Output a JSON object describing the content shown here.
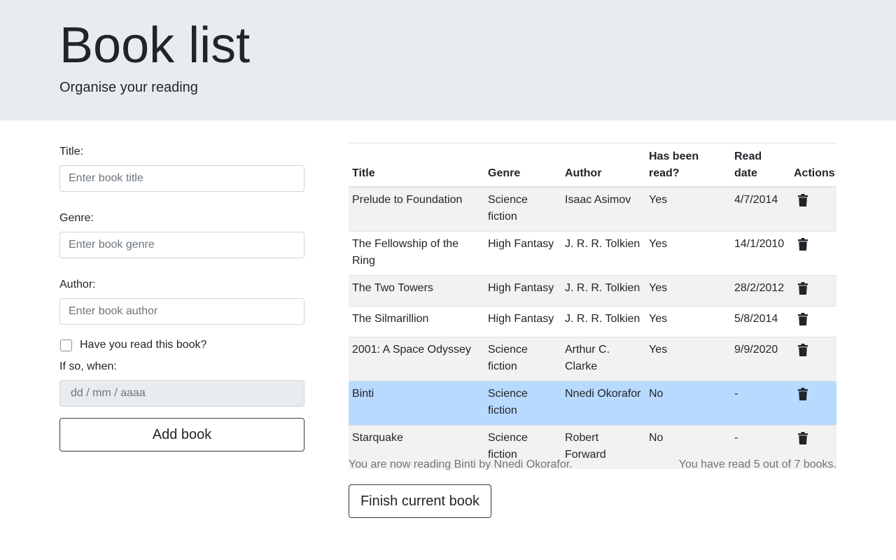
{
  "header": {
    "title": "Book list",
    "subtitle": "Organise your reading"
  },
  "form": {
    "title_label": "Title:",
    "title_placeholder": "Enter book title",
    "genre_label": "Genre:",
    "genre_placeholder": "Enter book genre",
    "author_label": "Author:",
    "author_placeholder": "Enter book author",
    "read_checkbox_label": "Have you read this book?",
    "read_checked": false,
    "date_label": "If so, when:",
    "date_placeholder": "dd / mm / aaaa",
    "add_button": "Add book"
  },
  "table": {
    "headers": [
      "Title",
      "Genre",
      "Author",
      "Has been read?",
      "Read date",
      "Actions"
    ],
    "rows": [
      {
        "title": "Prelude to Foundation",
        "genre": "Science fiction",
        "author": "Isaac Asimov",
        "read": "Yes",
        "date": "4/7/2014",
        "state": "striped"
      },
      {
        "title": "The Fellowship of the Ring",
        "genre": "High Fantasy",
        "author": "J. R. R. Tolkien",
        "read": "Yes",
        "date": "14/1/2010",
        "state": "plain"
      },
      {
        "title": "The Two Towers",
        "genre": "High Fantasy",
        "author": "J. R. R. Tolkien",
        "read": "Yes",
        "date": "28/2/2012",
        "state": "striped"
      },
      {
        "title": "The Silmarillion",
        "genre": "High Fantasy",
        "author": "J. R. R. Tolkien",
        "read": "Yes",
        "date": "5/8/2014",
        "state": "plain"
      },
      {
        "title": "2001: A Space Odyssey",
        "genre": "Science fiction",
        "author": "Arthur C. Clarke",
        "read": "Yes",
        "date": "9/9/2020",
        "state": "striped"
      },
      {
        "title": "Binti",
        "genre": "Science fiction",
        "author": "Nnedi Okorafor",
        "read": "No",
        "date": "-",
        "state": "active"
      },
      {
        "title": "Starquake",
        "genre": "Science fiction",
        "author": "Robert Forward",
        "read": "No",
        "date": "-",
        "state": "striped"
      }
    ],
    "action_icon": "trash-icon"
  },
  "status": {
    "current": "You are now reading Binti by Nnedi Okorafor.",
    "progress": "You have read 5 out of 7 books."
  },
  "finish_button": "Finish current book",
  "colors": {
    "header_bg": "#e9ecef",
    "active_row": "#b8daff",
    "striped_row": "#f2f2f2",
    "muted_text": "#6c757d"
  }
}
